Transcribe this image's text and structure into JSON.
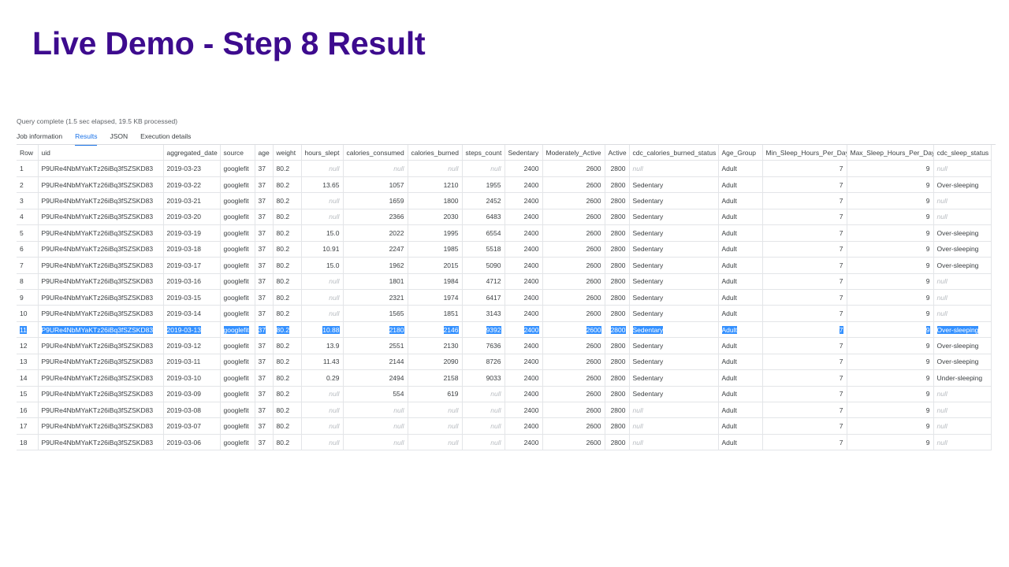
{
  "slide": {
    "title": "Live Demo - Step 8 Result"
  },
  "query": {
    "status": "Query complete (1.5 sec elapsed, 19.5 KB processed)"
  },
  "tabs": [
    {
      "label": "Job information",
      "active": false
    },
    {
      "label": "Results",
      "active": true
    },
    {
      "label": "JSON",
      "active": false
    },
    {
      "label": "Execution details",
      "active": false
    }
  ],
  "selected_row": 11,
  "null_text": "null",
  "accent_color": "#1a73e8",
  "title_color": "#3d0b8e",
  "selection_color": "#3390ff",
  "table": {
    "columns": [
      {
        "key": "row",
        "label": "Row",
        "align": "left",
        "width": 27
      },
      {
        "key": "uid",
        "label": "uid",
        "align": "left",
        "width": 159
      },
      {
        "key": "aggregated_date",
        "label": "aggregated_date",
        "align": "left",
        "width": 72
      },
      {
        "key": "source",
        "label": "source",
        "align": "left",
        "width": 44
      },
      {
        "key": "age",
        "label": "age",
        "align": "left",
        "width": 23
      },
      {
        "key": "weight",
        "label": "weight",
        "align": "left",
        "width": 36
      },
      {
        "key": "hours_slept",
        "label": "hours_slept",
        "align": "right",
        "width": 53
      },
      {
        "key": "calories_consumed",
        "label": "calories_consumed",
        "align": "right",
        "width": 82
      },
      {
        "key": "calories_burned",
        "label": "calories_burned",
        "align": "right",
        "width": 69
      },
      {
        "key": "steps_count",
        "label": "steps_count",
        "align": "right",
        "width": 54
      },
      {
        "key": "sedentary",
        "label": "Sedentary",
        "align": "right",
        "width": 48
      },
      {
        "key": "moderately_active",
        "label": "Moderately_Active",
        "align": "right",
        "width": 79
      },
      {
        "key": "active",
        "label": "Active",
        "align": "right",
        "width": 31
      },
      {
        "key": "cdc_calories_burned_status",
        "label": "cdc_calories_burned_status",
        "align": "left",
        "width": 113
      },
      {
        "key": "age_group",
        "label": "Age_Group",
        "align": "left",
        "width": 56
      },
      {
        "key": "min_sleep",
        "label": "Min_Sleep_Hours_Per_Day",
        "align": "right",
        "width": 107
      },
      {
        "key": "max_sleep",
        "label": "Max_Sleep_Hours_Per_Day",
        "align": "right",
        "width": 110
      },
      {
        "key": "cdc_sleep_status",
        "label": "cdc_sleep_status",
        "align": "left",
        "width": 73
      }
    ],
    "rows": [
      [
        "1",
        "P9URe4NbMYaKTz26iBq3fSZSKD83",
        "2019-03-23",
        "googlefit",
        "37",
        "80.2",
        null,
        null,
        null,
        null,
        "2400",
        "2600",
        "2800",
        null,
        "Adult",
        "7",
        "9",
        null
      ],
      [
        "2",
        "P9URe4NbMYaKTz26iBq3fSZSKD83",
        "2019-03-22",
        "googlefit",
        "37",
        "80.2",
        "13.65",
        "1057",
        "1210",
        "1955",
        "2400",
        "2600",
        "2800",
        "Sedentary",
        "Adult",
        "7",
        "9",
        "Over-sleeping"
      ],
      [
        "3",
        "P9URe4NbMYaKTz26iBq3fSZSKD83",
        "2019-03-21",
        "googlefit",
        "37",
        "80.2",
        null,
        "1659",
        "1800",
        "2452",
        "2400",
        "2600",
        "2800",
        "Sedentary",
        "Adult",
        "7",
        "9",
        null
      ],
      [
        "4",
        "P9URe4NbMYaKTz26iBq3fSZSKD83",
        "2019-03-20",
        "googlefit",
        "37",
        "80.2",
        null,
        "2366",
        "2030",
        "6483",
        "2400",
        "2600",
        "2800",
        "Sedentary",
        "Adult",
        "7",
        "9",
        null
      ],
      [
        "5",
        "P9URe4NbMYaKTz26iBq3fSZSKD83",
        "2019-03-19",
        "googlefit",
        "37",
        "80.2",
        "15.0",
        "2022",
        "1995",
        "6554",
        "2400",
        "2600",
        "2800",
        "Sedentary",
        "Adult",
        "7",
        "9",
        "Over-sleeping"
      ],
      [
        "6",
        "P9URe4NbMYaKTz26iBq3fSZSKD83",
        "2019-03-18",
        "googlefit",
        "37",
        "80.2",
        "10.91",
        "2247",
        "1985",
        "5518",
        "2400",
        "2600",
        "2800",
        "Sedentary",
        "Adult",
        "7",
        "9",
        "Over-sleeping"
      ],
      [
        "7",
        "P9URe4NbMYaKTz26iBq3fSZSKD83",
        "2019-03-17",
        "googlefit",
        "37",
        "80.2",
        "15.0",
        "1962",
        "2015",
        "5090",
        "2400",
        "2600",
        "2800",
        "Sedentary",
        "Adult",
        "7",
        "9",
        "Over-sleeping"
      ],
      [
        "8",
        "P9URe4NbMYaKTz26iBq3fSZSKD83",
        "2019-03-16",
        "googlefit",
        "37",
        "80.2",
        null,
        "1801",
        "1984",
        "4712",
        "2400",
        "2600",
        "2800",
        "Sedentary",
        "Adult",
        "7",
        "9",
        null
      ],
      [
        "9",
        "P9URe4NbMYaKTz26iBq3fSZSKD83",
        "2019-03-15",
        "googlefit",
        "37",
        "80.2",
        null,
        "2321",
        "1974",
        "6417",
        "2400",
        "2600",
        "2800",
        "Sedentary",
        "Adult",
        "7",
        "9",
        null
      ],
      [
        "10",
        "P9URe4NbMYaKTz26iBq3fSZSKD83",
        "2019-03-14",
        "googlefit",
        "37",
        "80.2",
        null,
        "1565",
        "1851",
        "3143",
        "2400",
        "2600",
        "2800",
        "Sedentary",
        "Adult",
        "7",
        "9",
        null
      ],
      [
        "11",
        "P9URe4NbMYaKTz26iBq3fSZSKD83",
        "2019-03-13",
        "googlefit",
        "37",
        "80.2",
        "10.88",
        "2180",
        "2146",
        "9392",
        "2400",
        "2600",
        "2800",
        "Sedentary",
        "Adult",
        "7",
        "9",
        "Over-sleeping"
      ],
      [
        "12",
        "P9URe4NbMYaKTz26iBq3fSZSKD83",
        "2019-03-12",
        "googlefit",
        "37",
        "80.2",
        "13.9",
        "2551",
        "2130",
        "7636",
        "2400",
        "2600",
        "2800",
        "Sedentary",
        "Adult",
        "7",
        "9",
        "Over-sleeping"
      ],
      [
        "13",
        "P9URe4NbMYaKTz26iBq3fSZSKD83",
        "2019-03-11",
        "googlefit",
        "37",
        "80.2",
        "11.43",
        "2144",
        "2090",
        "8726",
        "2400",
        "2600",
        "2800",
        "Sedentary",
        "Adult",
        "7",
        "9",
        "Over-sleeping"
      ],
      [
        "14",
        "P9URe4NbMYaKTz26iBq3fSZSKD83",
        "2019-03-10",
        "googlefit",
        "37",
        "80.2",
        "0.29",
        "2494",
        "2158",
        "9033",
        "2400",
        "2600",
        "2800",
        "Sedentary",
        "Adult",
        "7",
        "9",
        "Under-sleeping"
      ],
      [
        "15",
        "P9URe4NbMYaKTz26iBq3fSZSKD83",
        "2019-03-09",
        "googlefit",
        "37",
        "80.2",
        null,
        "554",
        "619",
        null,
        "2400",
        "2600",
        "2800",
        "Sedentary",
        "Adult",
        "7",
        "9",
        null
      ],
      [
        "16",
        "P9URe4NbMYaKTz26iBq3fSZSKD83",
        "2019-03-08",
        "googlefit",
        "37",
        "80.2",
        null,
        null,
        null,
        null,
        "2400",
        "2600",
        "2800",
        null,
        "Adult",
        "7",
        "9",
        null
      ],
      [
        "17",
        "P9URe4NbMYaKTz26iBq3fSZSKD83",
        "2019-03-07",
        "googlefit",
        "37",
        "80.2",
        null,
        null,
        null,
        null,
        "2400",
        "2600",
        "2800",
        null,
        "Adult",
        "7",
        "9",
        null
      ],
      [
        "18",
        "P9URe4NbMYaKTz26iBq3fSZSKD83",
        "2019-03-06",
        "googlefit",
        "37",
        "80.2",
        null,
        null,
        null,
        null,
        "2400",
        "2600",
        "2800",
        null,
        "Adult",
        "7",
        "9",
        null
      ]
    ]
  }
}
